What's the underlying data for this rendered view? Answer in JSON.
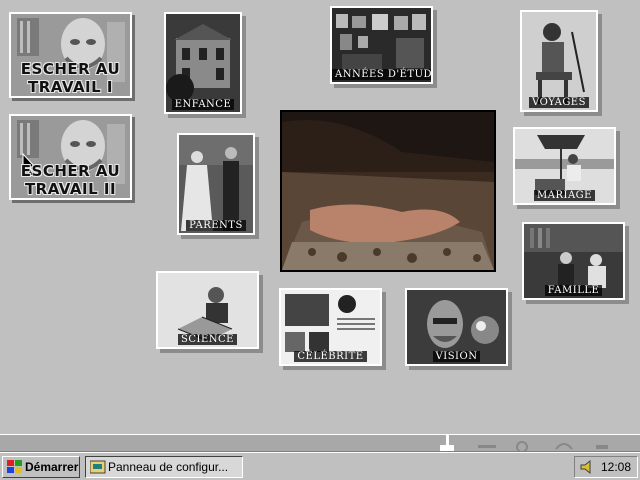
{
  "desktop": {
    "big_buttons": [
      {
        "line1": "ESCHER AU",
        "line2": "TRAVAIL I"
      },
      {
        "line1": "ESCHER AU",
        "line2": "TRAVAIL II"
      }
    ],
    "tiles": {
      "enfance": "ENFANCE",
      "etudes": "ANNÉES D'ÉTUDES",
      "voyages": "VOYAGES",
      "parents": "PARENTS",
      "mariage": "MARIAGE",
      "famille": "FAMILLE",
      "science": "SCIENCE",
      "celebrite": "CÉLÉBRITÉ",
      "vision": "VISION"
    }
  },
  "taskbar": {
    "start_label": "Démarrer",
    "task_label": "Panneau de configur...",
    "clock": "12:08"
  },
  "icons": {
    "start": "windows-logo-icon",
    "task": "control-panel-icon",
    "tray": "speaker-icon"
  }
}
